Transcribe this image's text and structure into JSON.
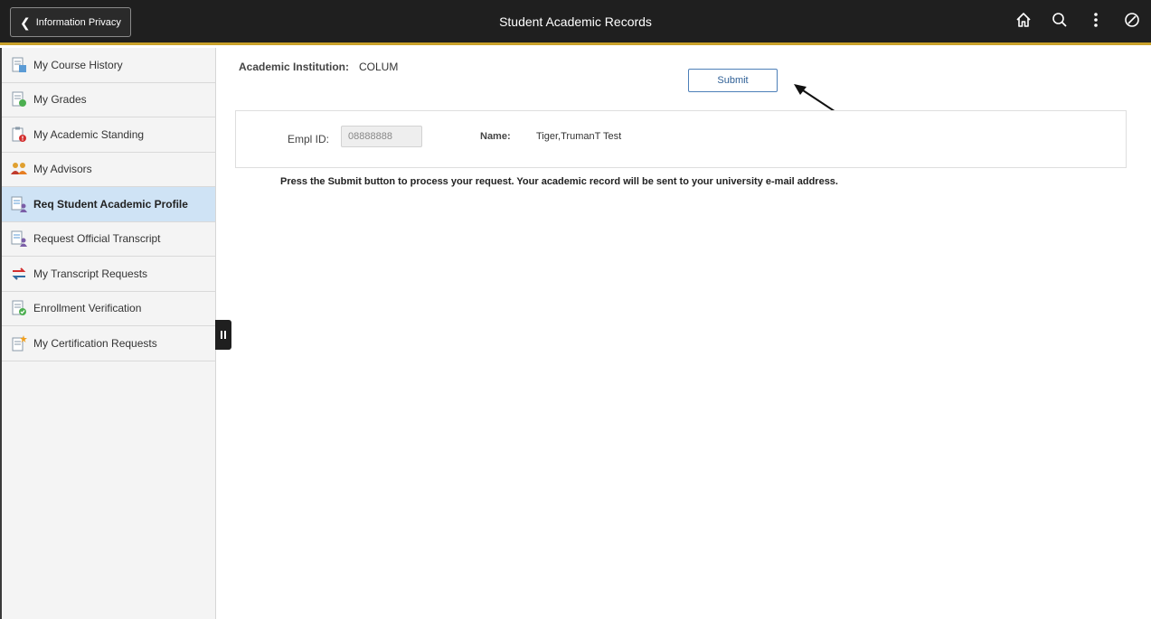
{
  "header": {
    "back_label": "Information Privacy",
    "title": "Student Academic Records",
    "icons": [
      "home-icon",
      "search-icon",
      "more-options-icon",
      "navbar-icon"
    ]
  },
  "sidebar": {
    "items": [
      {
        "label": "My Course History",
        "icon": "course-history-icon",
        "active": false
      },
      {
        "label": "My Grades",
        "icon": "grades-icon",
        "active": false
      },
      {
        "label": "My Academic Standing",
        "icon": "academic-standing-icon",
        "active": false
      },
      {
        "label": "My Advisors",
        "icon": "advisors-icon",
        "active": false
      },
      {
        "label": "Req Student Academic Profile",
        "icon": "academic-profile-icon",
        "active": true
      },
      {
        "label": "Request Official Transcript",
        "icon": "transcript-icon",
        "active": false
      },
      {
        "label": "My Transcript Requests",
        "icon": "transcript-requests-icon",
        "active": false
      },
      {
        "label": "Enrollment Verification",
        "icon": "enrollment-verification-icon",
        "active": false
      },
      {
        "label": "My Certification Requests",
        "icon": "certification-requests-icon",
        "active": false
      }
    ]
  },
  "main": {
    "institution_label": "Academic Institution:",
    "institution_value": "COLUM",
    "submit_label": "Submit",
    "empl_label": "Empl ID:",
    "empl_value": "08888888",
    "name_label": "Name:",
    "name_value": "Tiger,TrumanT Test",
    "instruction": "Press the Submit button to process your request. Your academic record will be sent to your university e-mail address."
  },
  "colors": {
    "header_bg": "#1f1f1f",
    "header_accent": "#c9a12a",
    "active_item_bg": "#cfe3f5",
    "submit_border": "#4d7fb8"
  }
}
